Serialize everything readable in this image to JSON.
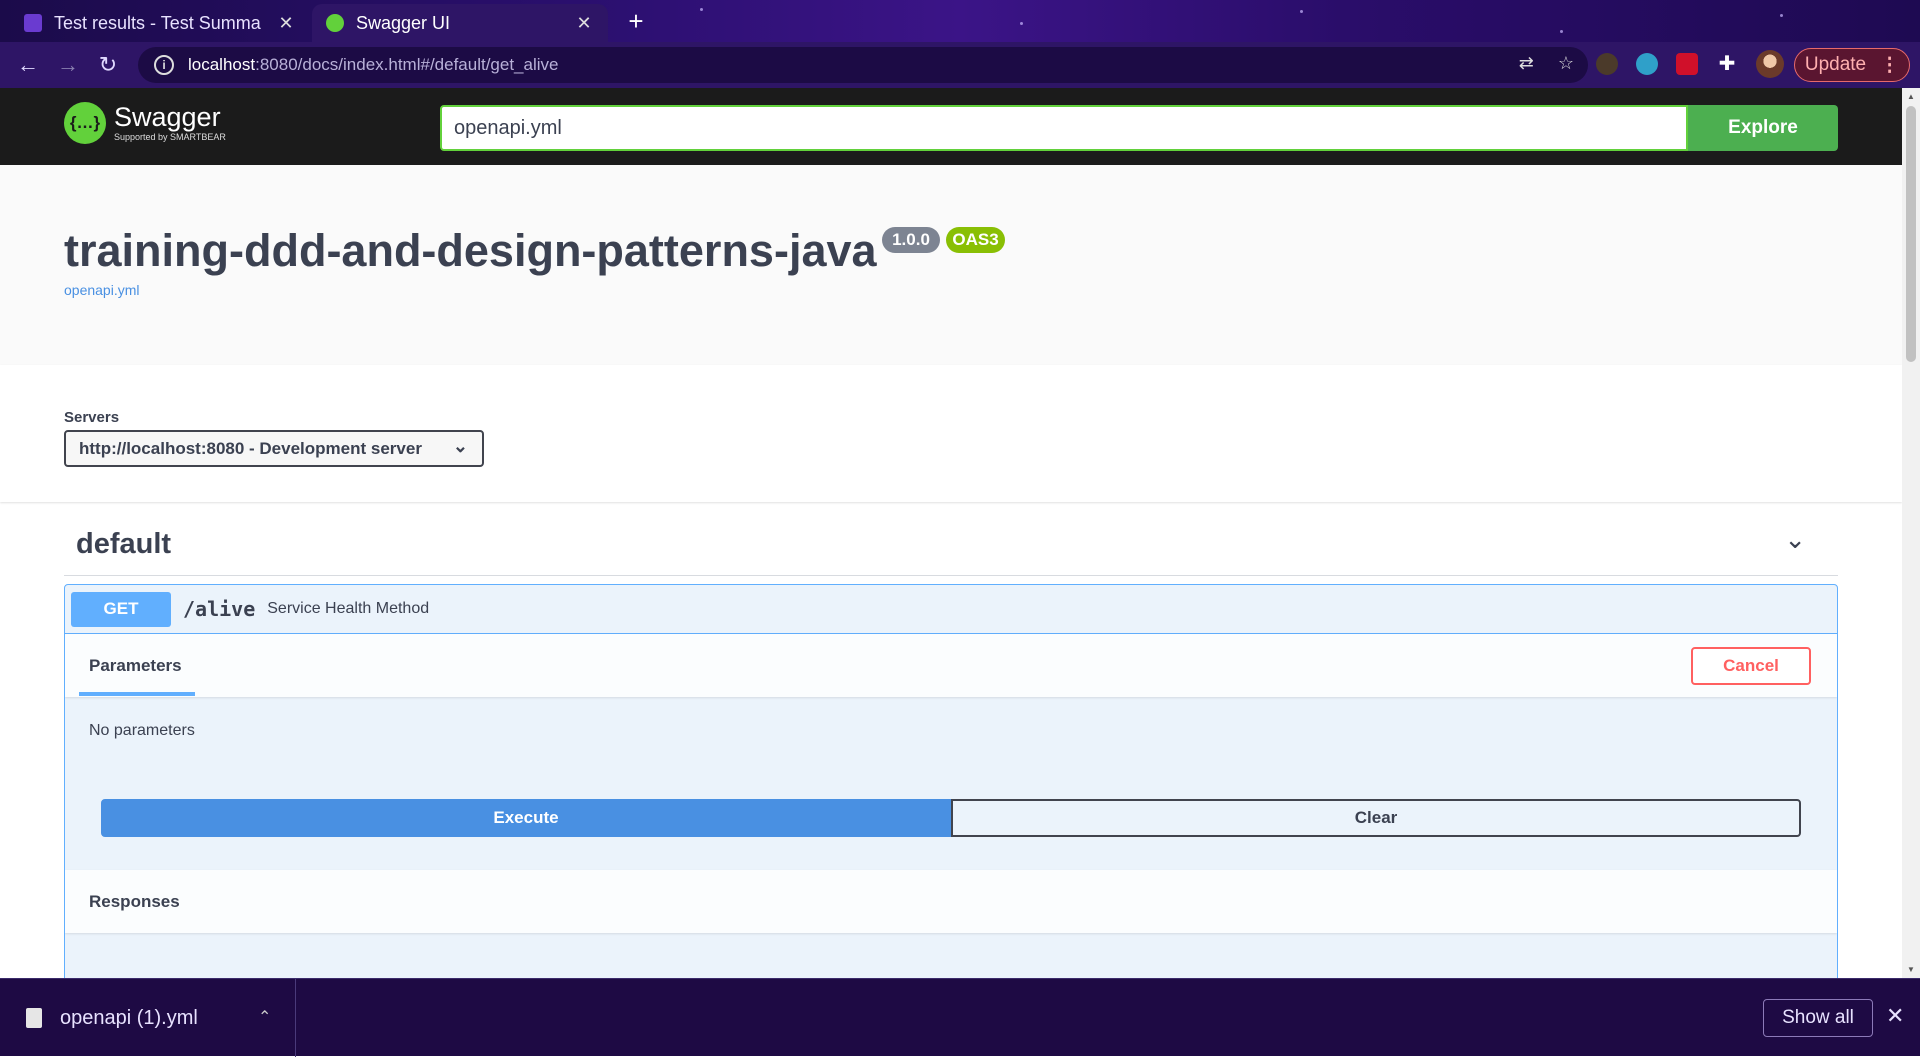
{
  "browser": {
    "tabs": [
      {
        "title": "Test results - Test Summa",
        "active": false
      },
      {
        "title": "Swagger UI",
        "active": true
      }
    ],
    "url_host": "localhost",
    "url_rest": ":8080/docs/index.html#/default/get_alive",
    "update_label": "Update"
  },
  "swagger": {
    "brand": "Swagger",
    "brand_sub": "Supported by SMARTBEAR",
    "spec_input_value": "openapi.yml",
    "explore_label": "Explore"
  },
  "info": {
    "title": "training-ddd-and-design-patterns-java",
    "version": "1.0.0",
    "oas": "OAS3",
    "spec_link": "openapi.yml"
  },
  "servers": {
    "label": "Servers",
    "selected": "http://localhost:8080 - Development server"
  },
  "tag": {
    "name": "default"
  },
  "operation": {
    "method": "GET",
    "path": "/alive",
    "description": "Service Health Method",
    "params_tab": "Parameters",
    "cancel_label": "Cancel",
    "no_params": "No parameters",
    "execute_label": "Execute",
    "clear_label": "Clear",
    "responses_label": "Responses"
  },
  "downloads": {
    "file": "openapi (1).yml",
    "show_all": "Show all"
  },
  "colors": {
    "get_method": "#61affe",
    "explore_green": "#4caf50",
    "cancel_red": "#ff6060",
    "execute_blue": "#4990e2"
  }
}
